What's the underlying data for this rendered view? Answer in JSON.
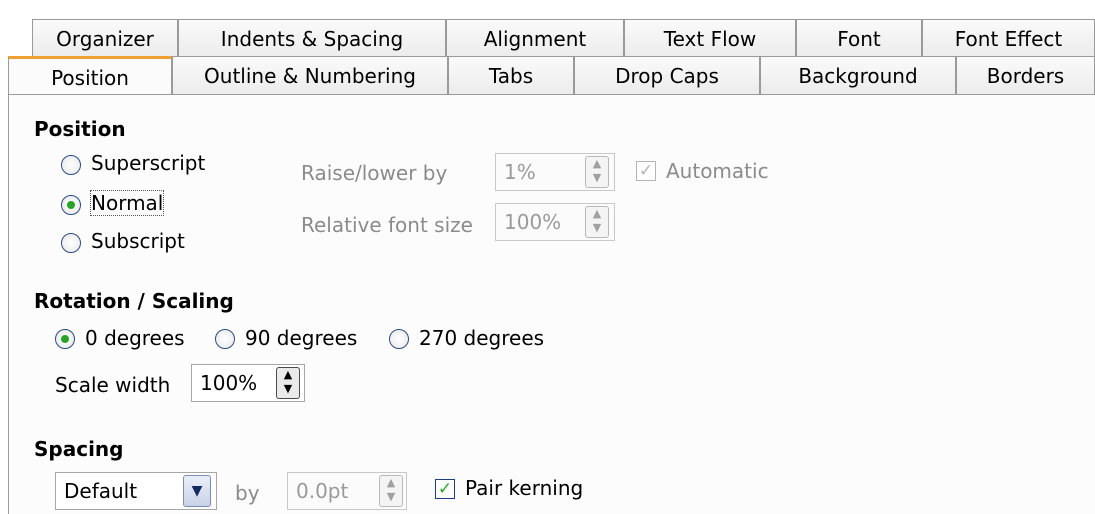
{
  "tabs_back": [
    "Organizer",
    "Indents & Spacing",
    "Alignment",
    "Text Flow",
    "Font",
    "Font Effect"
  ],
  "tabs_front": [
    "Position",
    "Outline & Numbering",
    "Tabs",
    "Drop Caps",
    "Background",
    "Borders"
  ],
  "position": {
    "header": "Position",
    "radios": [
      {
        "label": "Superscript",
        "mnemonic": "S",
        "selected": false
      },
      {
        "label": "Normal",
        "mnemonic": "N",
        "selected": true
      },
      {
        "label": "Subscript",
        "mnemonic": "u",
        "selected": false
      }
    ],
    "raise_label": "Raise/lower by",
    "raise_value": "1%",
    "automatic_label": "Automatic",
    "automatic_checked": true,
    "relsize_label": "Relative font size",
    "relsize_value": "100%"
  },
  "rotation": {
    "header": "Rotation / Scaling",
    "options": [
      {
        "label": "0 degrees",
        "selected": true
      },
      {
        "label": "90 degrees",
        "selected": false
      },
      {
        "label": "270 degrees",
        "selected": false
      }
    ],
    "scale_label": "Scale width",
    "scale_value": "100%"
  },
  "spacing": {
    "header": "Spacing",
    "mode_value": "Default",
    "by_label": "by",
    "by_value": "0.0pt",
    "pair_kerning_label": "Pair kerning",
    "pair_kerning_checked": true
  },
  "colors": {
    "accent_tab": "#f0a030",
    "radio_dot": "#27a327",
    "check": "#22aa22"
  }
}
